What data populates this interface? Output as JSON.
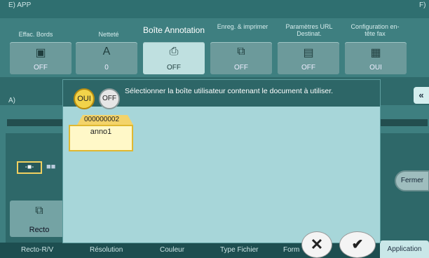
{
  "header": {
    "section_e": "E)  APP",
    "section_f": "F)",
    "section_a": "A)"
  },
  "tabs": [
    {
      "label": "Effac. Bords",
      "icon": "erase-border-icon",
      "value": "OFF"
    },
    {
      "label": "Netteté",
      "icon": "sharpness-icon",
      "value": "0"
    },
    {
      "label": "Boîte Annotation",
      "icon": "annotation-box-icon",
      "value": "OFF",
      "selected": true
    },
    {
      "label": "Enreg. & imprimer",
      "icon": "save-print-icon",
      "value": "OFF"
    },
    {
      "label": "Paramètres URL Destinat.",
      "icon": "url-destination-icon",
      "value": "OFF"
    },
    {
      "label": "Configuration en-tête fax",
      "icon": "fax-header-icon",
      "value": "OUI"
    }
  ],
  "dialog": {
    "oui_label": "OUI",
    "off_label": "OFF",
    "message": "Sélectionner la boîte utilisateur contenant le document à utiliser.",
    "folder": {
      "number": "000000002",
      "name": "anno1"
    }
  },
  "side": {
    "fermer_label": "Fermer",
    "recto_label": "Recto"
  },
  "bottom_tabs": [
    "Recto-R/V",
    "Résolution",
    "Couleur",
    "Type Fichier",
    "Form",
    "Application"
  ],
  "colors": {
    "accent_yellow": "#f2d34a",
    "dialog_bg": "#a7d6d9",
    "panel": "#3e7f80"
  }
}
